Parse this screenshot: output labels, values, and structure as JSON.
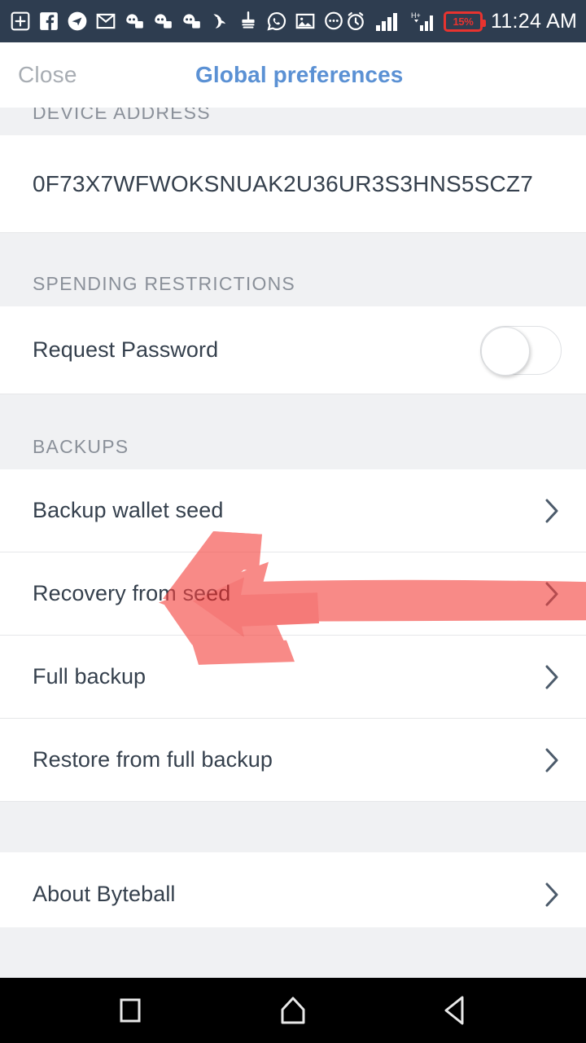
{
  "status_bar": {
    "time": "11:24 AM",
    "battery_text": "15%",
    "battery_color": "#e8332f",
    "background": "#2e3d50",
    "notification_icons": [
      "plus-square-icon",
      "facebook-icon",
      "telegram-icon",
      "gmail-icon",
      "ghost-chat-icon",
      "ghost-chat-icon",
      "ghost-chat-icon",
      "eagle-icon",
      "broom-cleaner-icon",
      "whatsapp-icon",
      "gallery-image-icon",
      "chat-dots-icon"
    ],
    "system_icons": [
      "alarm-clock-icon",
      "signal-bars-icon",
      "hspa-signal-icon",
      "battery-icon"
    ]
  },
  "header": {
    "close_label": "Close",
    "title": "Global preferences",
    "title_color": "#5b91d4",
    "close_color": "#a8adb3"
  },
  "sections": [
    {
      "header": "DEVICE ADDRESS",
      "rows": [
        {
          "label": "0F73X7WFWOKSNUAK2U36UR3S3HNS5SCZ7",
          "type": "value",
          "chevron": false
        }
      ]
    },
    {
      "header": "SPENDING RESTRICTIONS",
      "rows": [
        {
          "label": "Request Password",
          "type": "toggle",
          "toggle_state": "off",
          "chevron": false
        }
      ]
    },
    {
      "header": "BACKUPS",
      "rows": [
        {
          "label": "Backup wallet seed",
          "type": "link",
          "chevron": true
        },
        {
          "label": "Recovery from seed",
          "type": "link",
          "chevron": true
        },
        {
          "label": "Full backup",
          "type": "link",
          "chevron": true,
          "annotated": true
        },
        {
          "label": "Restore from full backup",
          "type": "link",
          "chevron": true
        }
      ]
    },
    {
      "header": "",
      "rows": [
        {
          "label": "About Byteball",
          "type": "link",
          "chevron": true
        }
      ]
    }
  ],
  "annotation": {
    "type": "arrow",
    "color": "#fa6a66",
    "direction": "left",
    "points_at": "Full backup",
    "description": "hand-drawn red arrow pointing left toward the Full backup row"
  },
  "bottom_nav": {
    "buttons": [
      "recents-square-icon",
      "home-icon",
      "back-triangle-icon"
    ],
    "background": "#000000"
  },
  "theme": {
    "section_bg": "#f0f1f3",
    "row_bg": "#ffffff",
    "text": "#35404d",
    "muted_text": "#8a9099",
    "divider": "#e6e7e9",
    "chevron": "#4c5b6b"
  }
}
